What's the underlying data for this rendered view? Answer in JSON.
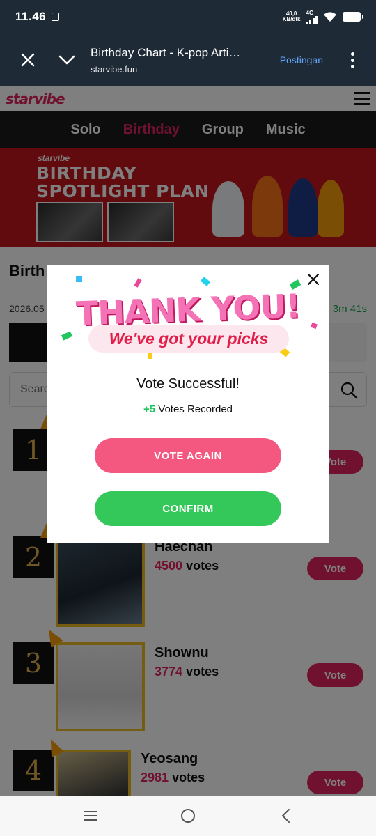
{
  "status_bar": {
    "time": "11.46",
    "net_speed_top": "40,0",
    "net_speed_bottom": "KB/dtk",
    "network_type": "4G"
  },
  "browser": {
    "title": "Birthday Chart - K-pop Arti…",
    "url": "starvibe.fun",
    "action": "Postingan"
  },
  "site": {
    "logo": "starvibe",
    "nav": [
      "Solo",
      "Birthday",
      "Group",
      "Music"
    ],
    "active_nav": "Birthday"
  },
  "banner": {
    "brand": "starvibe",
    "line1": "BIRTHDAY",
    "line2": "SPOTLIGHT PLAN"
  },
  "content": {
    "section_title": "Birth",
    "date": "2026.05",
    "countdown": "3m 41s",
    "search_placeholder": "Searc"
  },
  "rankings": [
    {
      "rank": "1",
      "name": "",
      "votes": "",
      "votes_label": "",
      "vote_label": "Vote"
    },
    {
      "rank": "2",
      "name": "Haechan",
      "votes": "4500",
      "votes_label": "votes",
      "vote_label": "Vote"
    },
    {
      "rank": "3",
      "name": "Shownu",
      "votes": "3774",
      "votes_label": "votes",
      "vote_label": "Vote"
    },
    {
      "rank": "4",
      "name": "Yeosang",
      "votes": "2981",
      "votes_label": "votes",
      "vote_label": "Vote"
    }
  ],
  "modal": {
    "headline": "THANK YOU!",
    "subline": "We've got your picks",
    "success": "Vote Successful!",
    "votes_plus": "+5",
    "votes_text": "Votes Recorded",
    "vote_again": "VOTE AGAIN",
    "confirm": "CONFIRM"
  },
  "colors": {
    "brand": "#e0245e",
    "gold": "#e8b923",
    "confirm": "#34c759",
    "again": "#f4577f"
  }
}
